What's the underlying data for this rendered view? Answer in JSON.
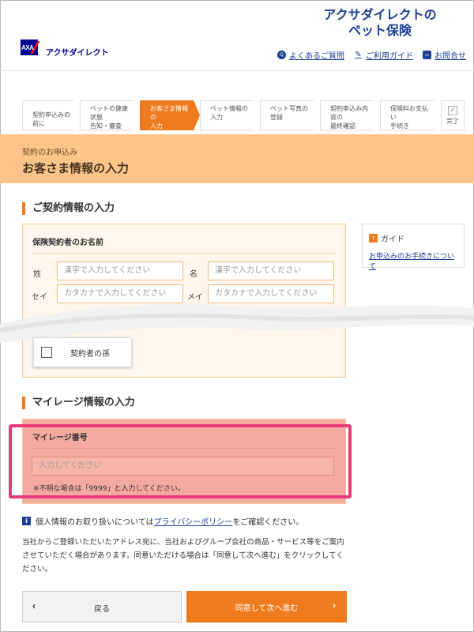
{
  "header": {
    "brand_logo": "AXA",
    "brand_name": "アクサダイレクト",
    "product_title_line1": "アクサダイレクトの",
    "product_title_line2": "ペット保険",
    "links": [
      {
        "label": "よくあるご質問",
        "icon": "question-icon"
      },
      {
        "label": "ご利用ガイド",
        "icon": "guide-icon"
      },
      {
        "label": "お問合せ",
        "icon": "chat-icon"
      }
    ]
  },
  "stepper": {
    "steps": [
      {
        "label": "契約申込みの前に",
        "state": "past"
      },
      {
        "label": "ペットの健康状態\n告知・審査",
        "state": "past"
      },
      {
        "label": "お客さま情報の\n入力",
        "state": "active"
      },
      {
        "label": "ペット情報の\n入力",
        "state": "future"
      },
      {
        "label": "ペット写真の\n登録",
        "state": "future"
      },
      {
        "label": "契約申込み内容の\n最終確認",
        "state": "future"
      },
      {
        "label": "保険料お支払い\n手続き",
        "state": "future"
      },
      {
        "label": "完了",
        "state": "future"
      }
    ]
  },
  "page_heading": {
    "sub": "契約のお申込み",
    "title": "お客さま情報の入力"
  },
  "contract": {
    "section_title": "ご契約情報の入力",
    "box_label": "保険契約者のお名前",
    "last_name_label": "姓",
    "first_name_label": "名",
    "last_kana_label": "セイ",
    "first_kana_label": "メイ",
    "kanji_placeholder": "漢字で入力してください",
    "kana_placeholder": "カタカナで入力してください",
    "checkbox_label": "契約者の孫"
  },
  "guide": {
    "title": "ガイド",
    "link": "お申込みのお手続きについて"
  },
  "mileage": {
    "section_title": "マイレージ情報の入力",
    "box_label": "マイレージ番号",
    "placeholder": "入力してください",
    "note": "※不明な場合は「9999」と入力してください。"
  },
  "privacy": {
    "prefix": "個人情報のお取り扱いについては",
    "link": "プライバシーポリシー",
    "suffix": "をご確認ください。",
    "consent": "当社からご登録いただいたアドレス宛に、当社およびグループ会社の商品・サービス等をご案内させていただく場合があります。同意いただける場合は「同意して次へ進む」をクリックしてください。"
  },
  "buttons": {
    "back": "戻る",
    "next": "同意して次へ進む"
  },
  "colors": {
    "accent": "#f07b1e",
    "brand": "#1c3f94",
    "highlight": "#e83a7a"
  }
}
